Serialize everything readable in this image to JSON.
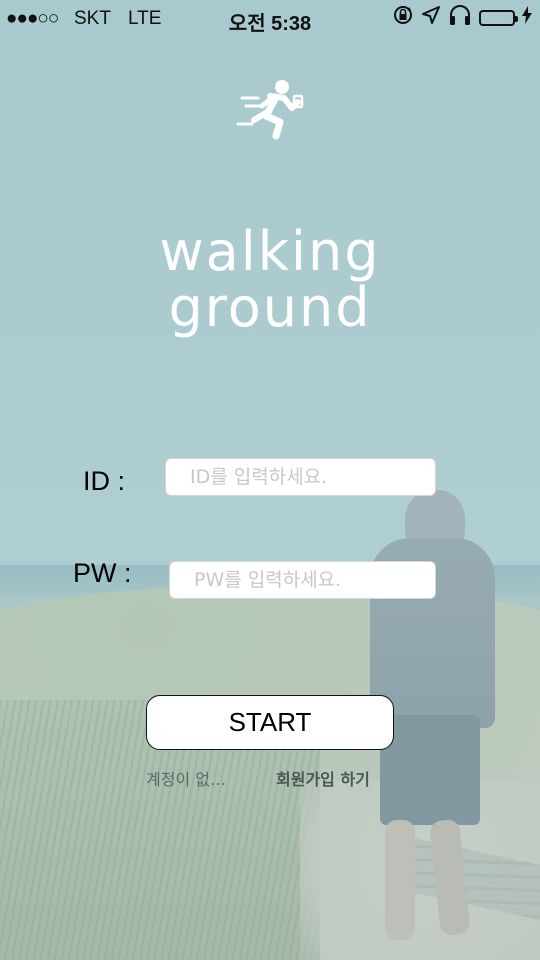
{
  "status_bar": {
    "signal": "●●●○○",
    "carrier": "SKT",
    "network": "LTE",
    "time": "오전 5:38",
    "icons": [
      "rotation-lock-icon",
      "location-icon",
      "headphones-icon",
      "battery-icon",
      "charging-icon"
    ],
    "battery_color": "#4cd964"
  },
  "app": {
    "title_line1": "walking",
    "title_line2": "ground",
    "logo_icon": "runner-icon"
  },
  "login": {
    "id_label": "ID :",
    "id_placeholder": "ID를 입력하세요.",
    "id_value": "",
    "pw_label": "PW :",
    "pw_placeholder": "PW를 입력하세요.",
    "pw_value": "",
    "start_label": "START",
    "no_account_text": "계정이 없…",
    "signup_label": "회원가입 하기"
  },
  "colors": {
    "background_tint": "#a8c6cb",
    "title": "#ffffff"
  }
}
